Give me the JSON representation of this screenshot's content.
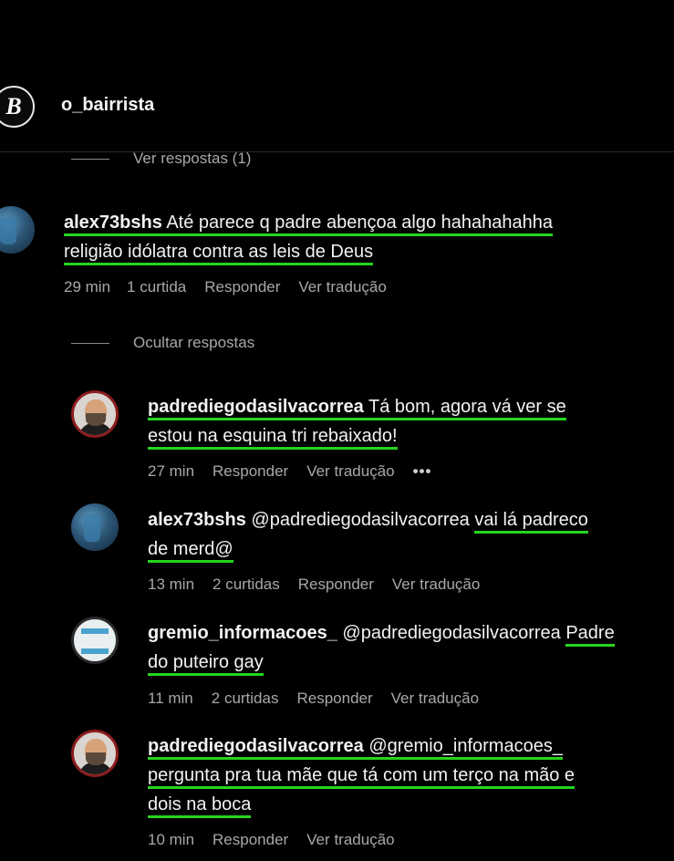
{
  "header": {
    "logo_letter": "B",
    "account": "o_bairrista"
  },
  "toggles": {
    "view_replies": "Ver respostas (1)",
    "hide_replies": "Ocultar respostas"
  },
  "comments": [
    {
      "user": "alex73bshs",
      "line1": "Até parece q padre abençoa algo hahahahahha",
      "line2": "religião idólatra contra as leis de Deus",
      "time": "29 min",
      "likes": "1 curtida",
      "reply": "Responder",
      "translate": "Ver tradução"
    },
    {
      "user": "padrediegodasilvacorrea",
      "line1": "Tá bom, agora vá ver se",
      "line2": "estou na esquina tri rebaixado!",
      "time": "27 min",
      "reply": "Responder",
      "translate": "Ver tradução",
      "more": "•••"
    },
    {
      "user": "alex73bshs",
      "mention": "@padrediegodasilvacorrea",
      "line1": "vai lá padreco",
      "line2": "de merd@",
      "time": "13 min",
      "likes": "2 curtidas",
      "reply": "Responder",
      "translate": "Ver tradução"
    },
    {
      "user": "gremio_informacoes_",
      "mention": "@padrediegodasilvacorrea",
      "line1": "Padre",
      "line2": "do puteiro gay",
      "time": "11 min",
      "likes": "2 curtidas",
      "reply": "Responder",
      "translate": "Ver tradução"
    },
    {
      "user": "padrediegodasilvacorrea",
      "mention": "@gremio_informacoes_",
      "line2": "pergunta pra tua mãe que tá com um terço na mão e",
      "line3": "dois na boca",
      "time": "10 min",
      "reply": "Responder",
      "translate": "Ver tradução"
    }
  ],
  "colors": {
    "background": "#000000",
    "highlight_underline": "#25d51e",
    "meta_text": "#a8a8a8"
  }
}
